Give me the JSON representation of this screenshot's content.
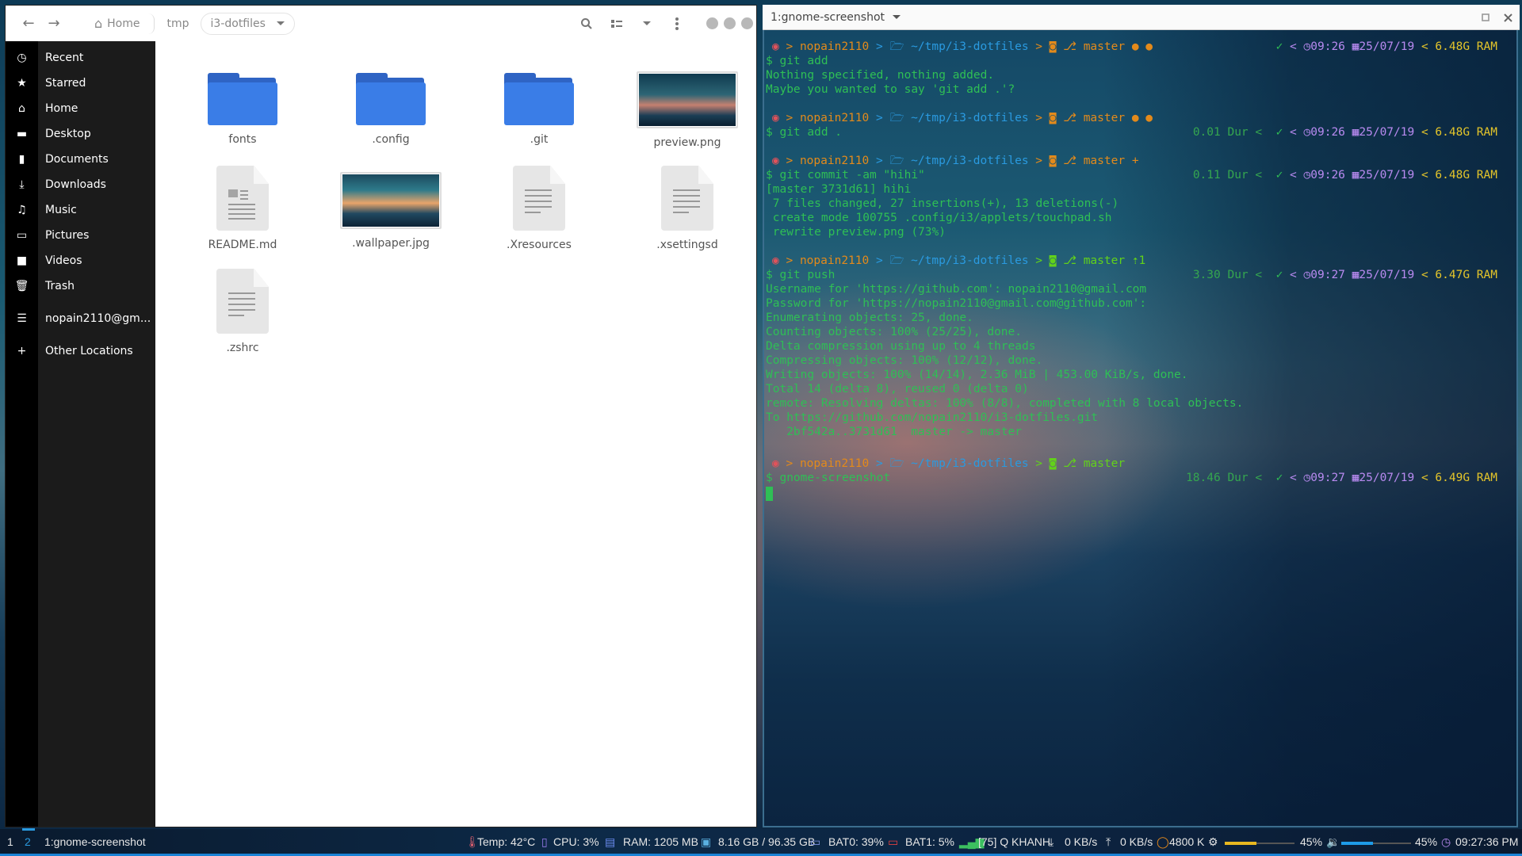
{
  "file_manager": {
    "breadcrumb": {
      "home": "Home",
      "tmp": "tmp",
      "current": "i3-dotfiles"
    },
    "icons": {
      "back": "arrow-left-icon",
      "forward": "arrow-right-icon",
      "search": "search-icon",
      "view": "list-view-icon",
      "sort": "chevron-down-icon",
      "menu": "kebab-menu-icon"
    },
    "sidebar": [
      {
        "label": "Recent",
        "icon": "clock-icon",
        "glyph": "◷"
      },
      {
        "label": "Starred",
        "icon": "star-icon",
        "glyph": "★"
      },
      {
        "label": "Home",
        "icon": "home-icon",
        "glyph": "⌂"
      },
      {
        "label": "Desktop",
        "icon": "desktop-icon",
        "glyph": "▬"
      },
      {
        "label": "Documents",
        "icon": "document-icon",
        "glyph": "▮"
      },
      {
        "label": "Downloads",
        "icon": "download-icon",
        "glyph": "⤓"
      },
      {
        "label": "Music",
        "icon": "music-icon",
        "glyph": "♫"
      },
      {
        "label": "Pictures",
        "icon": "picture-icon",
        "glyph": "▭"
      },
      {
        "label": "Videos",
        "icon": "video-icon",
        "glyph": "■"
      },
      {
        "label": "Trash",
        "icon": "trash-icon",
        "glyph": "🗑"
      },
      {
        "label": "nopain2110@gm...",
        "icon": "network-server-icon",
        "glyph": "☰"
      },
      {
        "label": "Other Locations",
        "icon": "plus-icon",
        "glyph": "+"
      }
    ],
    "files": [
      {
        "name": "fonts",
        "type": "folder"
      },
      {
        "name": ".config",
        "type": "folder"
      },
      {
        "name": ".git",
        "type": "folder"
      },
      {
        "name": "preview.png",
        "type": "image"
      },
      {
        "name": "README.md",
        "type": "markdown"
      },
      {
        "name": ".wallpaper.jpg",
        "type": "image"
      },
      {
        "name": ".Xresources",
        "type": "text"
      },
      {
        "name": ".xsettingsd",
        "type": "text"
      },
      {
        "name": ".zshrc",
        "type": "text"
      }
    ]
  },
  "terminal": {
    "title": "1:gnome-screenshot",
    "prompt": {
      "user": "nopain2110",
      "path": "~/tmp/i3-dotfiles",
      "branch": "master",
      "sep": ">",
      "ok_glyph": "✓",
      "clock_glyph": "◷",
      "cal_glyph": "▦"
    },
    "blocks": [
      {
        "status": "● ●",
        "command": "$ git add",
        "duration": "",
        "time": "09:26",
        "date": "25/07/19",
        "ram": "6.48G RAM",
        "output": [
          "Nothing specified, nothing added.",
          "Maybe you wanted to say 'git add .'?"
        ]
      },
      {
        "status": "● ●",
        "command": "$ git add .",
        "duration": "0.01 Dur",
        "time": "09:26",
        "date": "25/07/19",
        "ram": "6.48G RAM",
        "output": []
      },
      {
        "status": "+",
        "command": "$ git commit -am \"hihi\"",
        "duration": "0.11 Dur",
        "time": "09:26",
        "date": "25/07/19",
        "ram": "6.48G RAM",
        "output": [
          "[master 3731d61] hihi",
          " 7 files changed, 27 insertions(+), 13 deletions(-)",
          " create mode 100755 .config/i3/applets/touchpad.sh",
          " rewrite preview.png (73%)"
        ]
      },
      {
        "status": "⇡1",
        "command": "$ git push",
        "duration": "3.30 Dur",
        "time": "09:27",
        "date": "25/07/19",
        "ram": "6.47G RAM",
        "output": [
          "Username for 'https://github.com': nopain2110@gmail.com",
          "Password for 'https://nopain2110@gmail.com@github.com':",
          "Enumerating objects: 25, done.",
          "Counting objects: 100% (25/25), done.",
          "Delta compression using up to 4 threads",
          "Compressing objects: 100% (12/12), done.",
          "Writing objects: 100% (14/14), 2.36 MiB | 453.00 KiB/s, done.",
          "Total 14 (delta 8), reused 0 (delta 0)",
          "remote: Resolving deltas: 100% (8/8), completed with 8 local objects.",
          "To https://github.com/nopain2110/i3-dotfiles.git",
          "   2bf542a..3731d61  master -> master"
        ]
      },
      {
        "status": "",
        "command": "$ gnome-screenshot",
        "duration": "18.46 Dur",
        "time": "09:27",
        "date": "25/07/19",
        "ram": "6.49G RAM",
        "output": []
      }
    ]
  },
  "statusbar": {
    "workspaces": [
      "1",
      "2"
    ],
    "active_workspace": "2",
    "window_title": "1:gnome-screenshot",
    "temp": "Temp: 42°C",
    "cpu": "CPU: 3%",
    "ram": "RAM: 1205 MB",
    "disk": "8.16 GB / 96.35 GB",
    "bat0": "BAT0: 39%",
    "bat1": "BAT1: 5%",
    "wifi": "[75] Q KHANH",
    "down": "0 KB/s",
    "up": "0 KB/s",
    "color_temp": "4800 K",
    "brightness": {
      "label": "45%",
      "value": 0.45
    },
    "volume": {
      "label": "45%",
      "value": 0.45
    },
    "clock": "09:27:36 PM",
    "colors": {
      "accent": "#1a83d6",
      "brightness": "#e8b820",
      "volume": "#1e9be8",
      "bat1": "#e04040"
    }
  }
}
